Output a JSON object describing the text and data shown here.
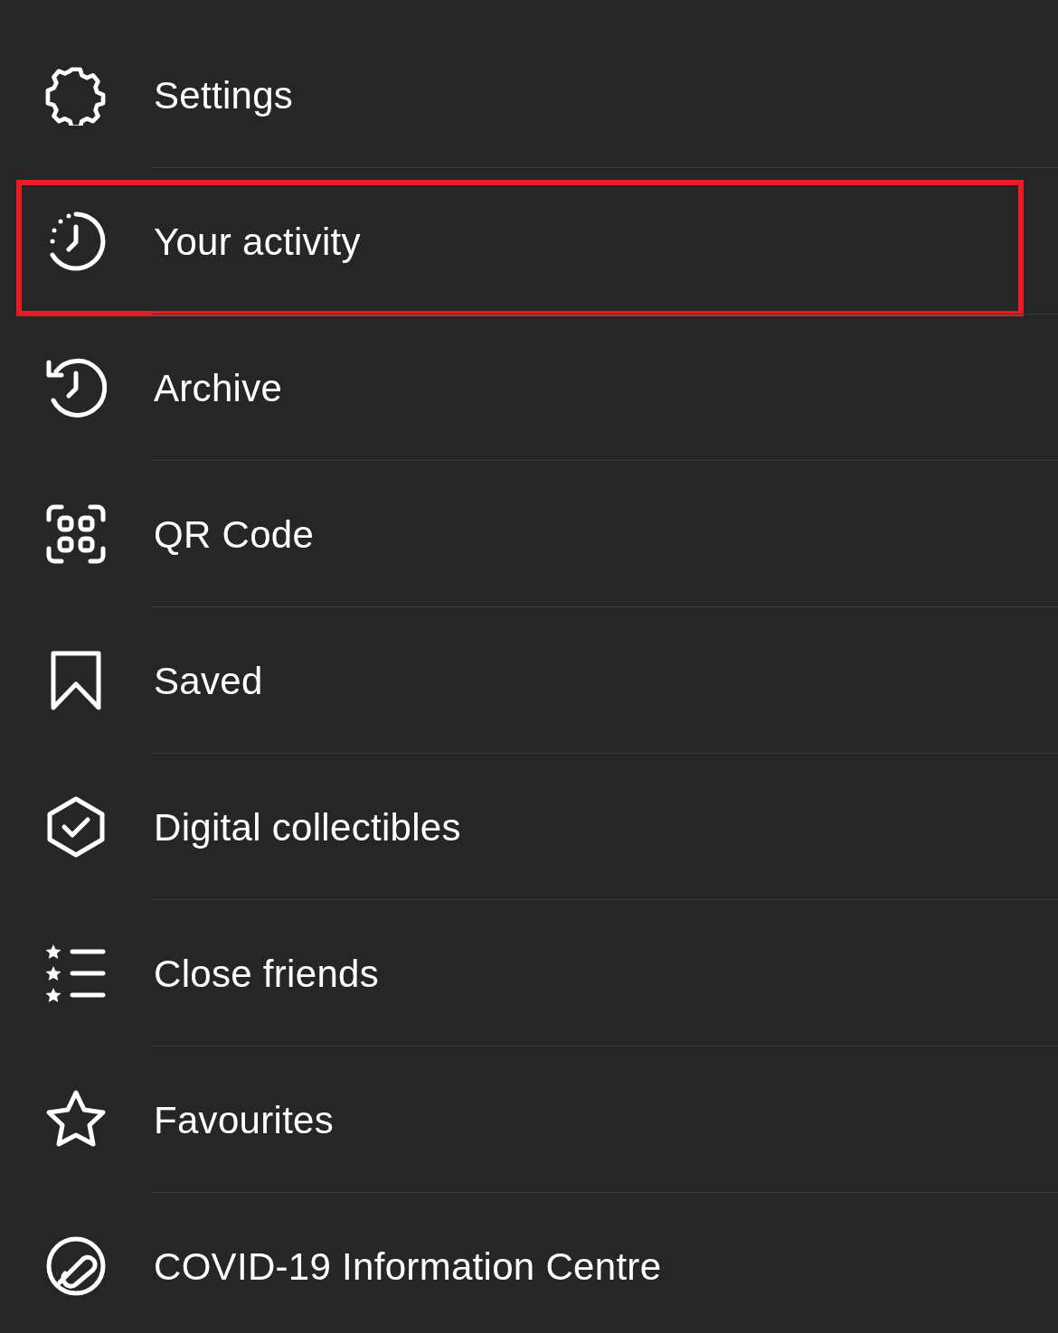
{
  "menu": {
    "items": [
      {
        "label": "Settings",
        "highlighted": false
      },
      {
        "label": "Your activity",
        "highlighted": true
      },
      {
        "label": "Archive",
        "highlighted": false
      },
      {
        "label": "QR Code",
        "highlighted": false
      },
      {
        "label": "Saved",
        "highlighted": false
      },
      {
        "label": "Digital collectibles",
        "highlighted": false
      },
      {
        "label": "Close friends",
        "highlighted": false
      },
      {
        "label": "Favourites",
        "highlighted": false
      },
      {
        "label": "COVID-19 Information Centre",
        "highlighted": false
      }
    ]
  }
}
